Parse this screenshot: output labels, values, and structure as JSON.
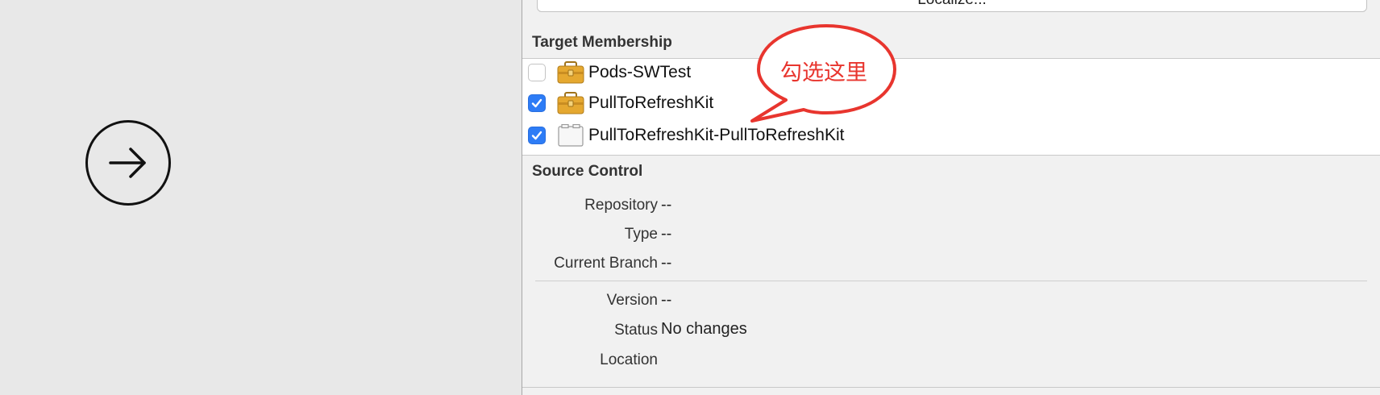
{
  "localize_button": "Localize...",
  "target_membership": {
    "title": "Target Membership",
    "items": [
      {
        "label": "Pods-SWTest",
        "checked": false,
        "icon": "toolbox-icon"
      },
      {
        "label": "PullToRefreshKit",
        "checked": true,
        "icon": "toolbox-icon"
      },
      {
        "label": "PullToRefreshKit-PullToRefreshKit",
        "checked": true,
        "icon": "bundle-icon"
      }
    ]
  },
  "source_control": {
    "title": "Source Control",
    "repository_label": "Repository",
    "repository_value": "--",
    "type_label": "Type",
    "type_value": "--",
    "branch_label": "Current Branch",
    "branch_value": "--",
    "version_label": "Version",
    "version_value": "--",
    "status_label": "Status",
    "status_value": "No changes",
    "location_label": "Location",
    "location_value": ""
  },
  "annotation": {
    "text": "勾选这里",
    "color": "#e8352e"
  },
  "colors": {
    "checkbox_accent": "#2d7cf6"
  }
}
